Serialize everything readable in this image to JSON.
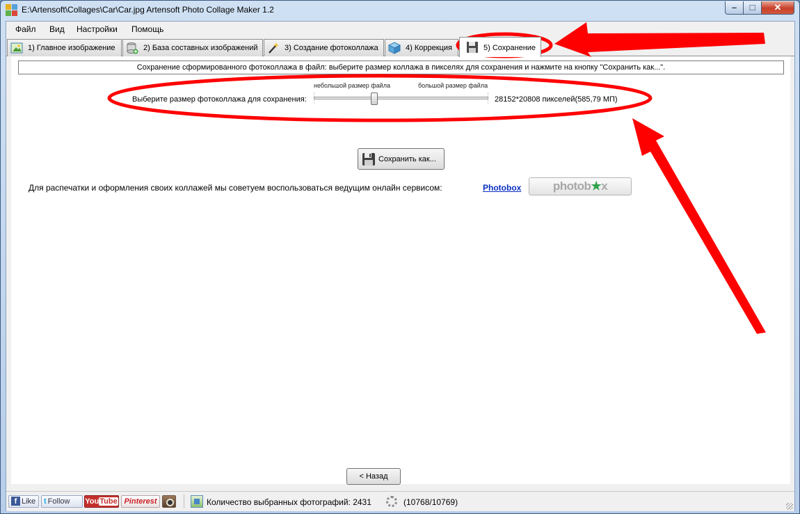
{
  "window": {
    "title": "E:\\Artensoft\\Collages\\Car\\Car.jpg Artensoft Photo Collage Maker 1.2",
    "controls": {
      "minimize": "–",
      "maximize": "□",
      "close": "✕"
    }
  },
  "menu": [
    "Файл",
    "Вид",
    "Настройки",
    "Помощь"
  ],
  "tabs": [
    {
      "label": "1) Главное изображение",
      "icon": "image-icon"
    },
    {
      "label": "2) База составных изображений",
      "icon": "database-add-icon"
    },
    {
      "label": "3) Создание фотоколлажа",
      "icon": "magic-wand-icon"
    },
    {
      "label": "4) Коррекция",
      "icon": "cube-icon"
    },
    {
      "label": "5) Сохранение",
      "icon": "floppy-disk-icon",
      "active": true
    }
  ],
  "save_page": {
    "hint": "Сохранение сформированного фотоколлажа в файл:  выберите размер коллажа в пикселях для сохранения и нажмите на кнопку \"Сохранить как...\".",
    "size_label": "Выберите размер фотоколлажа для сохранения:",
    "slider_min_caption": "небольшой размер файла",
    "slider_max_caption": "большой размер файла",
    "slider_value_fraction": 0.34,
    "size_readout": "28152*20808 пикселей(585,79 МП)",
    "save_button": "Сохранить как...",
    "promo_text": "Для распечатки и оформления своих коллажей мы советуем воспользоваться ведущим онлайн сервисом:",
    "promo_link": "Photobox",
    "photobox_logo_a": "photob",
    "photobox_logo_star": "★",
    "photobox_logo_b": "x",
    "back_button": "< Назад"
  },
  "statusbar": {
    "like": "Like",
    "like_glyph": "f",
    "follow": "Follow",
    "follow_glyph": "t",
    "youtube_a": "You",
    "youtube_b": "Tube",
    "pinterest": "Pinterest",
    "photo_count": "Количество выбранных фотографий: 2431",
    "progress": "(10768/10769)"
  },
  "colors": {
    "annotation": "#ff0000",
    "link": "#0a2fbf",
    "photobox_star": "#2fa34a"
  }
}
